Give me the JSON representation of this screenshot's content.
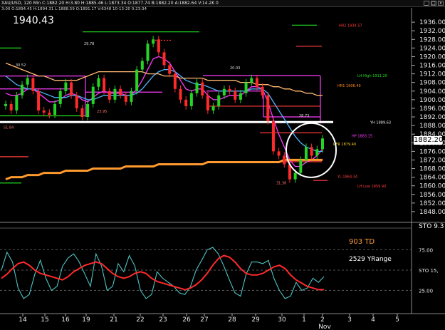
{
  "window": {
    "title": "XAU/USD, 120 Min  C:1882.20  H:3.80  H:1885.46  L:1873.34  O:1877.74  B:1882.20  A:1882.64  V:14.2K  0",
    "info_line": "3:00  O:1894.45  H:1894.31  L:1888.59  O:1891.17  V:6348  10-13-20  0:23:34",
    "buttons": [
      "_",
      "□",
      "x"
    ]
  },
  "header": {
    "big_price": "1940.43"
  },
  "chart_data": [
    {
      "type": "line",
      "name": "price-panel",
      "y_ticks": [
        1936,
        1932,
        1928,
        1924,
        1920,
        1916,
        1912,
        1908,
        1904,
        1900,
        1896,
        1892,
        1888,
        1884,
        1880,
        1876,
        1872,
        1868,
        1864,
        1860,
        1856,
        1852,
        1848
      ],
      "y_tick_labels": [
        "1936.00",
        "1932.00",
        "1928.00",
        "1924.00",
        "1920.00",
        "1916.00",
        "1912.00",
        "1908.00",
        "1904.00",
        "1900.00",
        "1896.00",
        "1892.00",
        "1888.00",
        "1884.00",
        "1880.00",
        "1876.00",
        "1872.00",
        "1868.00",
        "1864.00",
        "1860.00",
        "1856.00",
        "1852.00",
        "1848.00"
      ],
      "ylim": [
        1845,
        1941
      ],
      "current_price": "1882.20",
      "x_labels": [
        "14",
        "15",
        "16",
        "19",
        "21",
        "22",
        "23",
        "26",
        "27",
        "28",
        "29",
        "30",
        "1",
        "2",
        "3",
        "4",
        "5"
      ],
      "x_sub_label": "Nov",
      "price_labels": [
        {
          "text": "HR2 1934.57",
          "color": "#ff3b3b",
          "price": 1934.6
        },
        {
          "text": "LH High 1911.20",
          "color": "#20e020",
          "price": 1911.2
        },
        {
          "text": "HR1 1906.49",
          "color": "#ff8c1a",
          "price": 1906.5
        },
        {
          "text": "YH 1889.63",
          "color": "#e6e6e6",
          "price": 1889.6
        },
        {
          "text": "HP 1883.15",
          "color": "#ff3bff",
          "price": 1883.2
        },
        {
          "text": "RFR 1879.40",
          "color": "#ffd21a",
          "price": 1879.4
        },
        {
          "text": "YL 1864.34",
          "color": "#ff3b3b",
          "price": 1864.3
        },
        {
          "text": "LH Low 1859.90",
          "color": "#ff3b3b",
          "price": 1859.9
        }
      ],
      "annotations": [
        "30.52",
        "29.78",
        "23.95",
        "20.03",
        "28.73",
        "51.84",
        "31.36"
      ],
      "series": [
        {
          "name": "price",
          "color": "#25d425",
          "values": [
            1898,
            1895,
            1902,
            1907,
            1910,
            1904,
            1895,
            1894,
            1893,
            1898,
            1904,
            1908,
            1902,
            1896,
            1892,
            1898,
            1906,
            1910,
            1904,
            1900,
            1905,
            1902,
            1899,
            1904,
            1914,
            1918,
            1926,
            1928,
            1922,
            1916,
            1912,
            1905,
            1900,
            1897,
            1903,
            1908,
            1902,
            1895,
            1897,
            1902,
            1905,
            1904,
            1900,
            1903,
            1908,
            1910,
            1906,
            1902,
            1890,
            1876,
            1874,
            1870,
            1863,
            1866,
            1872,
            1878,
            1874,
            1877,
            1882
          ]
        },
        {
          "name": "fast-ma",
          "color": "#ff3bff",
          "values": [
            1903,
            1902,
            1902,
            1903,
            1905,
            1905,
            1903,
            1901,
            1899,
            1899,
            1900,
            1902,
            1903,
            1902,
            1900,
            1899,
            1901,
            1903,
            1904,
            1903,
            1903,
            1903,
            1902,
            1902,
            1905,
            1909,
            1914,
            1919,
            1920,
            1919,
            1917,
            1913,
            1909,
            1905,
            1904,
            1905,
            1905,
            1902,
            1900,
            1900,
            1901,
            1902,
            1902,
            1902,
            1904,
            1906,
            1906,
            1905,
            1899,
            1891,
            1884,
            1878,
            1872,
            1869,
            1869,
            1871,
            1872,
            1874,
            1877
          ]
        },
        {
          "name": "mid-ma",
          "color": "#4fb6ff",
          "values": [
            1911,
            1909,
            1907,
            1906,
            1905,
            1905,
            1904,
            1903,
            1902,
            1901,
            1901,
            1901,
            1902,
            1902,
            1901,
            1900,
            1900,
            1901,
            1902,
            1902,
            1902,
            1902,
            1902,
            1902,
            1903,
            1905,
            1908,
            1911,
            1913,
            1914,
            1914,
            1913,
            1911,
            1909,
            1908,
            1907,
            1907,
            1906,
            1905,
            1904,
            1904,
            1904,
            1904,
            1904,
            1904,
            1905,
            1905,
            1905,
            1903,
            1899,
            1895,
            1891,
            1887,
            1883,
            1880,
            1878,
            1877,
            1876,
            1876
          ]
        },
        {
          "name": "long-ma",
          "color": "#ffb870",
          "values": [
            1917,
            1916,
            1915,
            1914,
            1913,
            1912,
            1911,
            1911,
            1910,
            1909,
            1909,
            1909,
            1909,
            1909,
            1910,
            1911,
            1912,
            1913,
            1913,
            1913,
            1913,
            1913,
            1913,
            1913,
            1913,
            1913,
            1912,
            1912,
            1912,
            1911,
            1911,
            1911,
            1910,
            1910,
            1910,
            1910,
            1910,
            1909,
            1909,
            1909,
            1909,
            1909,
            1909,
            1908,
            1908,
            1908,
            1907,
            1907,
            1907,
            1906,
            1906,
            1905,
            1905,
            1904,
            1904,
            1903,
            1903,
            1902,
            1902
          ]
        },
        {
          "name": "200-ma",
          "color": "#ff9a2e",
          "values": [
            1863,
            1864,
            1864,
            1864,
            1865,
            1865,
            1865,
            1866,
            1866,
            1866,
            1866,
            1867,
            1867,
            1867,
            1867,
            1867,
            1868,
            1868,
            1868,
            1868,
            1868,
            1868,
            1869,
            1869,
            1869,
            1869,
            1869,
            1869,
            1870,
            1870,
            1870,
            1870,
            1870,
            1870,
            1870,
            1870,
            1870,
            1871,
            1871,
            1871,
            1871,
            1871,
            1871,
            1871,
            1871,
            1871,
            1871,
            1871,
            1871,
            1871,
            1871,
            1872,
            1872,
            1872,
            1872,
            1872,
            1872,
            1872,
            1872
          ]
        }
      ]
    },
    {
      "type": "line",
      "name": "stochastic-panel",
      "label": "STO 9.3",
      "y_ticks": [
        75,
        50,
        25
      ],
      "y_tick_labels": [
        "75.00",
        "STO 15,",
        "25.00"
      ],
      "ylim": [
        0,
        100
      ],
      "series": [
        {
          "name": "fast",
          "color": "#4fc3c3",
          "values": [
            50,
            72,
            60,
            28,
            15,
            20,
            45,
            62,
            40,
            25,
            30,
            55,
            65,
            70,
            60,
            45,
            30,
            70,
            55,
            25,
            30,
            58,
            48,
            68,
            55,
            25,
            15,
            20,
            48,
            40,
            35,
            30,
            22,
            20,
            30,
            50,
            62,
            75,
            78,
            70,
            55,
            38,
            22,
            18,
            45,
            60,
            60,
            58,
            62,
            40,
            25,
            15,
            18,
            35,
            25,
            28,
            40,
            35,
            42
          ]
        },
        {
          "name": "slow",
          "color": "#ff2a2a",
          "values": [
            40,
            45,
            52,
            58,
            60,
            56,
            50,
            46,
            44,
            42,
            40,
            38,
            42,
            48,
            52,
            56,
            58,
            60,
            58,
            52,
            46,
            42,
            40,
            42,
            46,
            48,
            46,
            40,
            36,
            34,
            32,
            30,
            28,
            26,
            28,
            32,
            38,
            46,
            56,
            64,
            68,
            66,
            60,
            52,
            46,
            44,
            44,
            46,
            50,
            54,
            56,
            52,
            44,
            38,
            34,
            30,
            28,
            26,
            26
          ]
        }
      ]
    }
  ],
  "indicators": {
    "td": "903 TD",
    "yrange": "2529 YRange",
    "sto": "STO 9.3"
  }
}
